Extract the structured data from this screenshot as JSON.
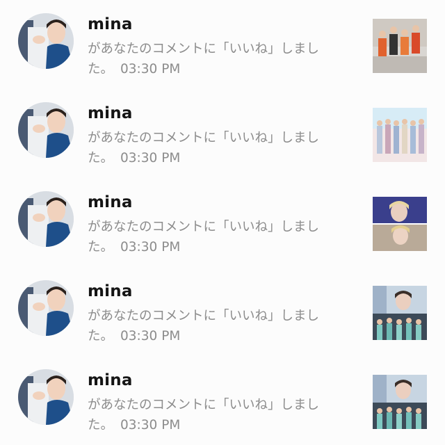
{
  "notifications": [
    {
      "user": "mina",
      "message": "があなたのコメントに「いいね」しました。",
      "time": "03:30 PM",
      "avatar_icon": "user-avatar-photo",
      "thumbnail": "group-photo-orange"
    },
    {
      "user": "mina",
      "message": "があなたのコメントに「いいね」しました。",
      "time": "03:30 PM",
      "avatar_icon": "user-avatar-photo",
      "thumbnail": "group-photo-pastel"
    },
    {
      "user": "mina",
      "message": "があなたのコメントに「いいね」しました。",
      "time": "03:30 PM",
      "avatar_icon": "user-avatar-photo",
      "thumbnail": "portrait-collage"
    },
    {
      "user": "mina",
      "message": "があなたのコメントに「いいね」しました。",
      "time": "03:30 PM",
      "avatar_icon": "user-avatar-photo",
      "thumbnail": "group-photo-blue"
    },
    {
      "user": "mina",
      "message": "があなたのコメントに「いいね」しました。",
      "time": "03:30 PM",
      "avatar_icon": "user-avatar-photo",
      "thumbnail": "group-photo-blue"
    }
  ],
  "colors": {
    "background": "#fcfcfc",
    "username": "#151515",
    "message": "#8c8c8c"
  }
}
